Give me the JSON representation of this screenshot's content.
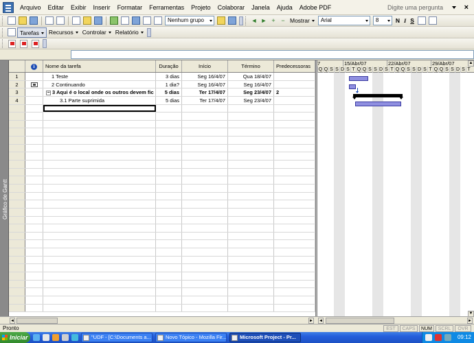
{
  "menu": {
    "items": [
      "Arquivo",
      "Editar",
      "Exibir",
      "Inserir",
      "Formatar",
      "Ferramentas",
      "Projeto",
      "Colaborar",
      "Janela",
      "Ajuda",
      "Adobe PDF"
    ],
    "help_placeholder": "Digite uma pergunta",
    "close_glyph": "×"
  },
  "toolbar1": {
    "group_combo": "Nenhum grupo",
    "show_label": "Mostrar",
    "font_combo": "Arial",
    "size_combo": "8",
    "bold": "N",
    "italic": "I",
    "underline": "S"
  },
  "toolbar2": {
    "tasks": "Tarefas",
    "resources": "Recursos",
    "control": "Controlar",
    "report": "Relatório"
  },
  "view_bar_label": "Gráfico de Gantt",
  "table": {
    "headers": {
      "info_glyph": "i",
      "name": "Nome da tarefa",
      "duration": "Duração",
      "start": "Início",
      "finish": "Término",
      "predecessors": "Predecessoras"
    },
    "rows": [
      {
        "id": "1",
        "name": "1 Teste",
        "duration": "3 dias",
        "start": "Seg 16/4/07",
        "finish": "Qua 18/4/07",
        "pred": ""
      },
      {
        "id": "2",
        "name": "2 Continuando",
        "duration": "1 dia?",
        "start": "Seg 16/4/07",
        "finish": "Seg 16/4/07",
        "pred": ""
      },
      {
        "id": "3",
        "name": "3 Aqui é o local onde os outros devem fic",
        "duration": "5 dias",
        "start": "Ter 17/4/07",
        "finish": "Seg 23/4/07",
        "pred": "2"
      },
      {
        "id": "4",
        "name": "3.1 Parte suprimida",
        "duration": "5 dias",
        "start": "Ter 17/4/07",
        "finish": "Seg 23/4/07",
        "pred": ""
      }
    ],
    "summary_toggle": "−"
  },
  "gantt": {
    "weeks": [
      "15/Abr/07",
      "22/Abr/07",
      "29/Abr/07"
    ],
    "days": [
      "Q",
      "Q",
      "S",
      "S",
      "D",
      "S",
      "T",
      "Q",
      "Q",
      "S",
      "S",
      "D",
      "S",
      "T",
      "Q",
      "Q",
      "S",
      "S",
      "D",
      "S",
      "T",
      "Q",
      "Q",
      "S",
      "S",
      "D",
      "S",
      "T"
    ],
    "edge_marker": "7"
  },
  "status": {
    "text": "Pronto",
    "indicators": [
      "EST",
      "CAPS",
      "NUM",
      "SCRL",
      "OVR"
    ]
  },
  "taskbar": {
    "start": "Iniciar",
    "tasks": [
      "\"UDF - [C:\\Documents a...",
      "Novo Tópico - Mozilla Fir...",
      "Microsoft Project - Pr..."
    ],
    "clock": "09:12"
  },
  "colors": {
    "task_bar": "#8f8fe0",
    "summary_bar": "#000000",
    "dependency": "#1f4eb5"
  }
}
